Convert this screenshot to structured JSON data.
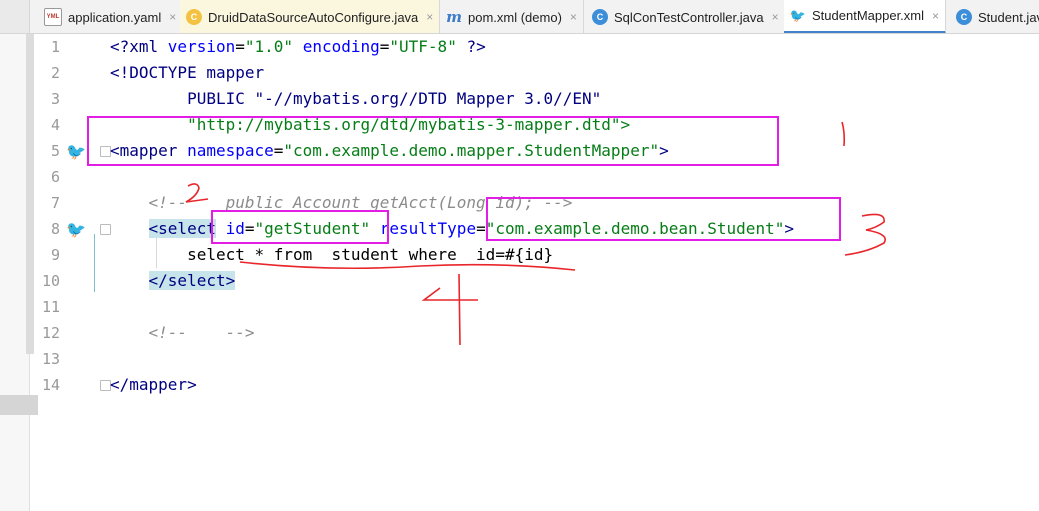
{
  "tabs": [
    {
      "label": "application.yaml",
      "icon": "yaml-file-icon",
      "icon_text": "YML"
    },
    {
      "label": "DruidDataSourceAutoConfigure.java",
      "icon": "java-class-icon",
      "icon_text": "C"
    },
    {
      "label": "pom.xml (demo)",
      "icon": "maven-icon",
      "icon_text": "m"
    },
    {
      "label": "SqlConTestController.java",
      "icon": "java-class-icon",
      "icon_text": "C"
    },
    {
      "label": "StudentMapper.xml",
      "icon": "mybatis-bird-icon",
      "icon_text": "🐦"
    },
    {
      "label": "Student.java",
      "icon": "java-class-icon",
      "icon_text": "C"
    }
  ],
  "close_glyph": "×",
  "line_numbers": [
    "1",
    "2",
    "3",
    "4",
    "5",
    "6",
    "7",
    "8",
    "9",
    "10",
    "11",
    "12",
    "13",
    "14"
  ],
  "code": {
    "l1_a": "<?xml ",
    "l1_b": "version",
    "l1_c": "=",
    "l1_d": "\"1.0\"",
    "l1_e": " ",
    "l1_f": "encoding",
    "l1_g": "=",
    "l1_h": "\"UTF-8\"",
    "l1_i": " ?>",
    "l2": "<!DOCTYPE mapper",
    "l3": "        PUBLIC \"-//mybatis.org//DTD Mapper 3.0//EN\"",
    "l4": "        \"http://mybatis.org/dtd/mybatis-3-mapper.dtd\">",
    "l5_a": "<mapper ",
    "l5_b": "namespace",
    "l5_c": "=",
    "l5_d": "\"com.example.demo.mapper.StudentMapper\"",
    "l5_e": ">",
    "l7": "    <!--    public Account getAcct(Long id); -->",
    "l8_a": "<select",
    "l8_b": " id",
    "l8_c": "=",
    "l8_d": "\"getStudent\"",
    "l8_e": " resultType",
    "l8_f": "=",
    "l8_g": "\"com.example.demo.bean.Student\"",
    "l8_h": ">",
    "l9": "        select * from  student where  id=#{id}",
    "l10": "</select>",
    "l12": "    <!--    -->",
    "l14": "</mapper>"
  },
  "gutter_icons": {
    "icon": "mybatis-bird-icon",
    "glyph": "🐦"
  },
  "annotations": {
    "mark1": "1",
    "mark2": "2",
    "mark3": "3",
    "mark4": "4",
    "color": "#e21ee6",
    "ink_color": "#e8262b"
  }
}
